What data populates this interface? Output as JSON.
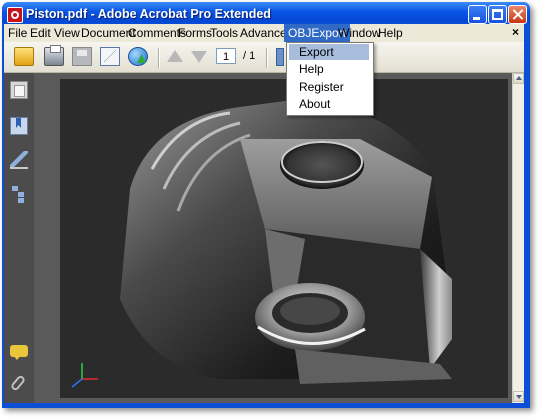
{
  "window": {
    "title": "Piston.pdf - Adobe Acrobat Pro Extended"
  },
  "menubar": {
    "items": [
      "File",
      "Edit",
      "View",
      "Document",
      "Comments",
      "Forms",
      "Tools",
      "Advanced",
      "OBJExport",
      "Window",
      "Help"
    ],
    "active": "OBJExport",
    "close_glyph": "×"
  },
  "toolbar": {
    "page_current": "1",
    "page_total": "/ 1"
  },
  "objexport_menu": {
    "items": [
      "Export",
      "Help",
      "Register",
      "About"
    ],
    "highlighted": "Export"
  },
  "icons": {
    "toolbar": [
      "folder-open-icon",
      "print-icon",
      "save-icon",
      "email-icon",
      "web-share-icon",
      "previous-page-icon",
      "next-page-icon",
      "select-tool-icon"
    ],
    "navigation": [
      "pages-icon",
      "bookmarks-icon",
      "signatures-icon",
      "model-tree-icon",
      "comments-icon",
      "attachments-icon"
    ]
  },
  "colors": {
    "titlebar": "#0a55e4",
    "menu_highlight": "#316ac5",
    "dropdown_highlight": "#a8bcdc",
    "navpane": "#4c4c4c",
    "canvas": "#2b2b2b"
  }
}
